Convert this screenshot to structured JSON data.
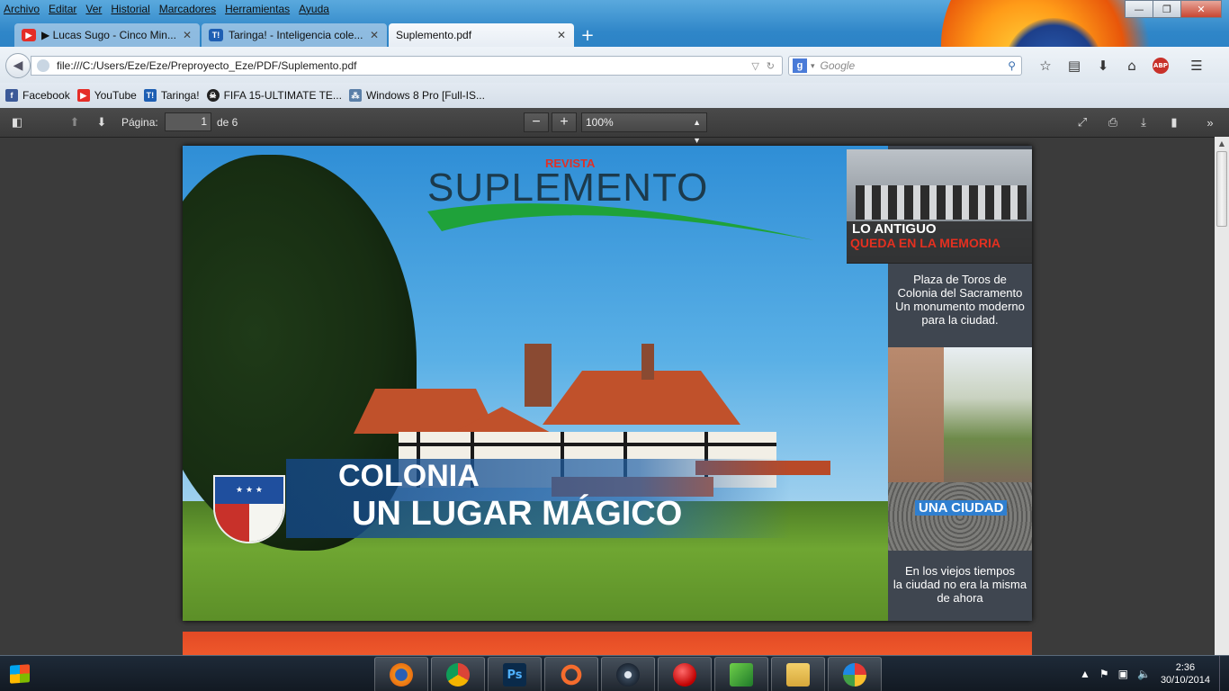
{
  "menu": [
    "Archivo",
    "Editar",
    "Ver",
    "Historial",
    "Marcadores",
    "Herramientas",
    "Ayuda"
  ],
  "tabs": [
    {
      "label": "▶ Lucas Sugo - Cinco Min...",
      "icon": "youtube-icon",
      "color": "#e52d27"
    },
    {
      "label": "Taringa! - Inteligencia cole...",
      "icon": "taringa-icon",
      "color": "#1e5fb3"
    },
    {
      "label": "Suplemento.pdf",
      "icon": "",
      "color": ""
    }
  ],
  "window_buttons": {
    "minimize": "—",
    "maximize": "❐",
    "close": "✕"
  },
  "nav": {
    "url": "file:///C:/Users/Eze/Eze/Preproyecto_Eze/PDF/Suplemento.pdf",
    "search_placeholder": "Google",
    "search_engine_letter": "g"
  },
  "bookmarks": [
    {
      "label": "Facebook",
      "icon": "facebook-icon",
      "color": "#3b5998"
    },
    {
      "label": "YouTube",
      "icon": "youtube-icon",
      "color": "#e52d27"
    },
    {
      "label": "Taringa!",
      "icon": "taringa-icon",
      "color": "#1e5fb3"
    },
    {
      "label": "FIFA 15-ULTIMATE TE...",
      "icon": "skull-icon",
      "color": "#222222"
    },
    {
      "label": "Windows 8 Pro [Full-IS...",
      "icon": "network-icon",
      "color": "#5a7fa8"
    }
  ],
  "pdf_toolbar": {
    "page_label": "Página:",
    "page_value": "1",
    "page_total": "de 6",
    "zoom_out": "−",
    "zoom_in": "+",
    "zoom": "100%"
  },
  "pdf_page": {
    "revista": "REVISTA",
    "title": "SUPLEMENTO",
    "banner_line1": "COLONIA",
    "banner_line2": "UN LUGAR MÁGICO",
    "side_title1": "LO ANTIGUO",
    "side_title2": "QUEDA EN LA MEMORIA",
    "side_desc1": [
      "Plaza de Toros de",
      "Colonia del Sacramento",
      "Un monumento moderno",
      "para la ciudad."
    ],
    "side_label2": "UNA CIUDAD",
    "side_desc2": [
      "En los viejos tiempos",
      "la ciudad no era la misma",
      "de ahora"
    ]
  },
  "taskbar": {
    "apps": [
      "firefox-icon",
      "chrome-icon",
      "photoshop-icon",
      "origin-icon",
      "steam-icon",
      "record-icon",
      "camtasia-icon",
      "explorer-icon",
      "paint-icon"
    ],
    "time": "2:36",
    "date": "30/10/2014"
  },
  "colors": {
    "accent_red": "#e43020",
    "banner_blue": "#2f7fd0",
    "page2_orange": "#e34a25"
  }
}
